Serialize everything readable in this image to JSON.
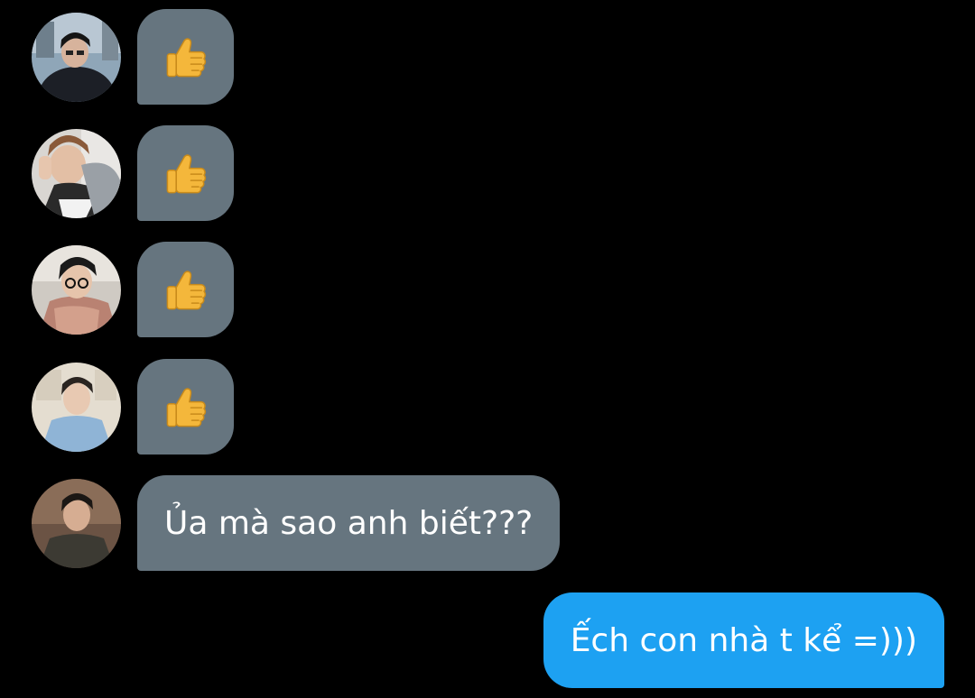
{
  "messages": [
    {
      "from": "incoming",
      "reaction": "thumbs-up"
    },
    {
      "from": "incoming",
      "reaction": "thumbs-up"
    },
    {
      "from": "incoming",
      "reaction": "thumbs-up"
    },
    {
      "from": "incoming",
      "reaction": "thumbs-up"
    },
    {
      "from": "incoming",
      "text": "Ủa mà sao anh biết???"
    },
    {
      "from": "outgoing",
      "text": "Ếch con nhà t kể =)))"
    }
  ],
  "colors": {
    "background": "#000000",
    "incoming_bubble": "#66757f",
    "outgoing_bubble": "#1da1f2",
    "text": "#ffffff"
  }
}
